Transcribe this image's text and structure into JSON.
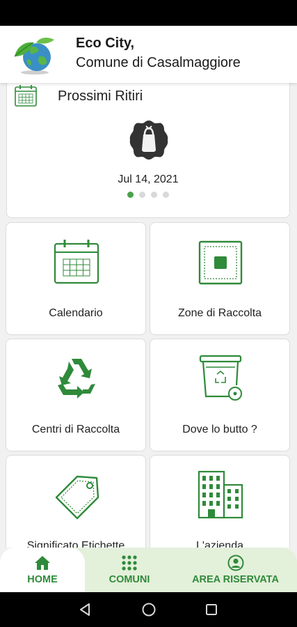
{
  "header": {
    "title": "Eco City,",
    "subtitle": "Comune di Casalmaggiore",
    "logo_icon": "eco-globe-leaf-logo"
  },
  "pickup_card": {
    "title": "Prossimi Ritiri",
    "icon": "calendar-icon",
    "badge_icon": "waste-bag-badge-icon",
    "date": "Jul 14, 2021",
    "carousel": {
      "pages": 4,
      "active_index": 0
    }
  },
  "tiles": [
    {
      "label": "Calendario",
      "icon": "calendar-icon"
    },
    {
      "label": "Zone di Raccolta",
      "icon": "collection-zone-icon"
    },
    {
      "label": "Centri di Raccolta",
      "icon": "recycle-icon"
    },
    {
      "label": "Dove lo butto ?",
      "icon": "recycle-bin-icon"
    },
    {
      "label": "Significato Etichette",
      "icon": "label-tag-icon"
    },
    {
      "label": "L'azienda",
      "icon": "company-building-icon"
    }
  ],
  "bottom_nav": [
    {
      "label": "HOME",
      "icon": "home-icon",
      "active": true
    },
    {
      "label": "COMUNI",
      "icon": "grid-dots-icon",
      "active": false
    },
    {
      "label": "AREA RISERVATA",
      "icon": "user-circle-icon",
      "active": false
    }
  ],
  "colors": {
    "accent_green": "#2f8a3a",
    "nav_background": "#e3f0da",
    "active_dot": "#4aa14a"
  }
}
